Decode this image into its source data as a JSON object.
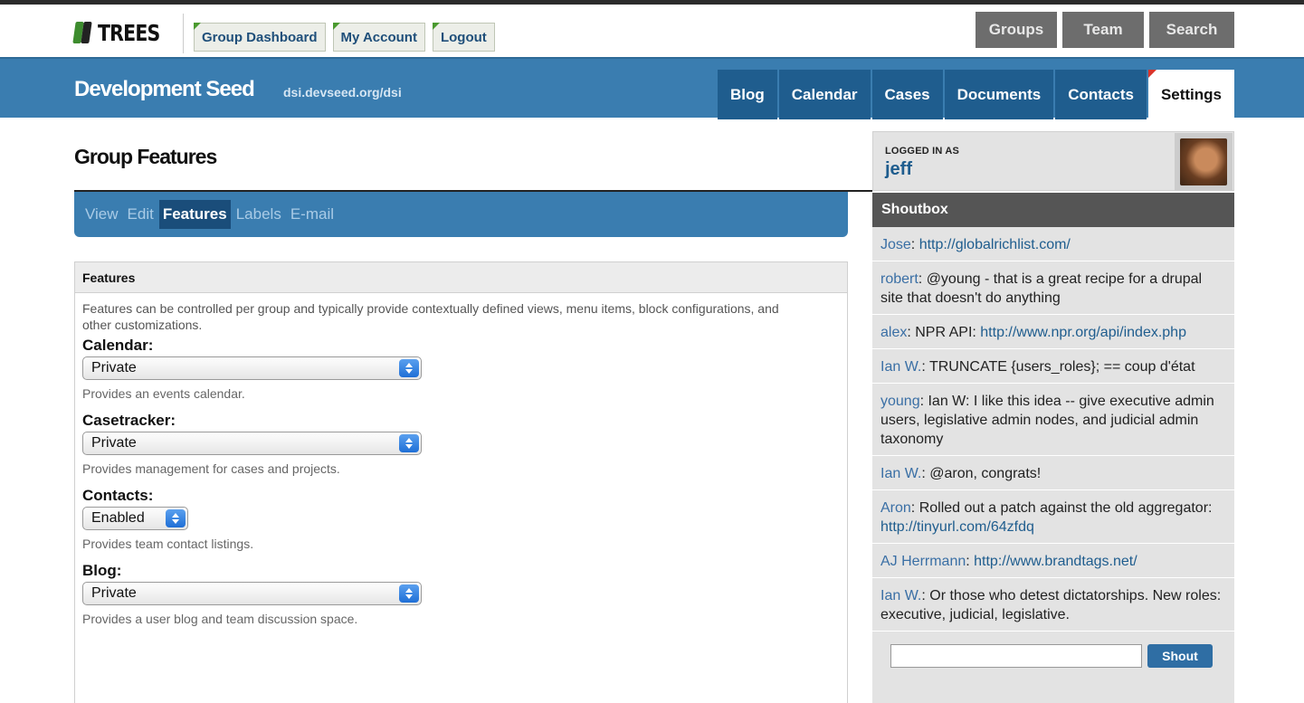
{
  "top": {
    "logo_text": "TREES",
    "user_links": [
      "Group Dashboard",
      "My Account",
      "Logout"
    ],
    "right_buttons": [
      "Groups",
      "Team",
      "Search"
    ]
  },
  "header": {
    "site_title": "Development Seed",
    "site_url": "dsi.devseed.org/dsi",
    "nav": [
      "Blog",
      "Calendar",
      "Cases",
      "Documents",
      "Contacts",
      "Settings"
    ],
    "active_nav": "Settings"
  },
  "main": {
    "page_title": "Group Features",
    "subtabs": [
      "View",
      "Edit",
      "Features",
      "Labels",
      "E-mail"
    ],
    "active_subtab": "Features",
    "fieldset": {
      "legend": "Features",
      "description": "Features can be controlled per group and typically provide contextually defined views, menu items, block configurations, and other customizations.",
      "features": [
        {
          "label": "Calendar:",
          "value": "Private",
          "help": "Provides an events calendar."
        },
        {
          "label": "Casetracker:",
          "value": "Private",
          "help": "Provides management for cases and projects."
        },
        {
          "label": "Contacts:",
          "value": "Enabled",
          "help": "Provides team contact listings."
        },
        {
          "label": "Blog:",
          "value": "Private",
          "help": "Provides a user blog and team discussion space."
        }
      ]
    }
  },
  "sidebar": {
    "logged_in_label": "LOGGED IN AS",
    "username": "jeff",
    "shoutbox_title": "Shoutbox",
    "shouts": [
      {
        "who": "Jose",
        "text": ": ",
        "link": "http://globalrichlist.com/",
        "after": ""
      },
      {
        "who": "robert",
        "text": ": @young - that is a great recipe for a drupal site that doesn't do anything",
        "link": "",
        "after": ""
      },
      {
        "who": "alex",
        "text": ": NPR API: ",
        "link": "http://www.npr.org/api/index.php",
        "after": ""
      },
      {
        "who": "Ian W.",
        "text": ": TRUNCATE {users_roles}; == coup d'état",
        "link": "",
        "after": ""
      },
      {
        "who": "young",
        "text": ": Ian W: I like this idea -- give executive admin users, legislative admin nodes, and judicial admin taxonomy",
        "link": "",
        "after": ""
      },
      {
        "who": "Ian W.",
        "text": ": @aron, congrats!",
        "link": "",
        "after": ""
      },
      {
        "who": "Aron",
        "text": ": Rolled out a patch against the old aggregator: ",
        "link": "http://tinyurl.com/64zfdq",
        "after": ""
      },
      {
        "who": "AJ Herrmann",
        "text": ": ",
        "link": "http://www.brandtags.net/",
        "after": ""
      },
      {
        "who": "Ian W.",
        "text": ": Or those who detest dictatorships. New roles: executive, judicial, legislative.",
        "link": "",
        "after": ""
      }
    ],
    "shout_button": "Shout"
  },
  "colors": {
    "brand_blue": "#3a7db0",
    "nav_dark_blue": "#1f5d8e",
    "accent_green": "#4a9a2f",
    "accent_red": "#d9342b"
  }
}
